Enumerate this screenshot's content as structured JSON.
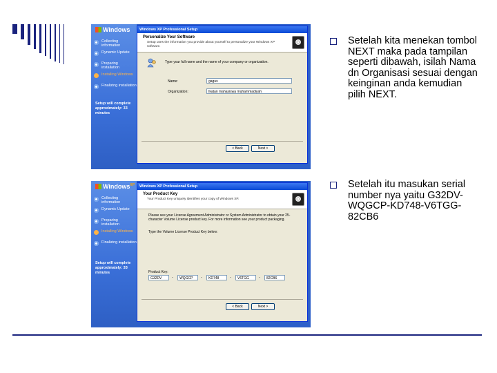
{
  "shot1": {
    "logo": "Windows",
    "steps": [
      "Collecting information",
      "Dynamic Update",
      "Preparing installation",
      "Installing Windows",
      "Finalizing installation"
    ],
    "remaining": "Setup will complete approximately: 33 minutes",
    "dialog_title": "Windows XP Professional Setup",
    "header_title": "Personalize Your Software",
    "header_sub": "Setup uses the information you provide about yourself to personalize your Windows XP software.",
    "prompt": "Type your full name and the name of your company or organization.",
    "name_label": "Name:",
    "name_value": "gagus",
    "org_label": "Organization:",
    "org_value": "Ikatan mahasiswa muhammadiyah",
    "back_label": "< Back",
    "next_label": "Next >"
  },
  "shot2": {
    "logo": "Windows",
    "logo_sup": "XP",
    "steps": [
      "Collecting information",
      "Dynamic Update",
      "Preparing installation",
      "Installing Windows",
      "Finalizing installation"
    ],
    "remaining": "Setup will complete approximately: 33 minutes",
    "dialog_title": "Windows XP Professional Setup",
    "header_title": "Your Product Key",
    "header_sub": "Your Product Key uniquely identifies your copy of Windows XP.",
    "para": "Please see your License Agreement Administrator or System Administrator to obtain your 25-character Volume License product key. For more information see your product packaging.",
    "prompt": "Type the Volume License Product Key below:",
    "key_label": "Product Key:",
    "key_parts": [
      "G32DV",
      "WQGCP",
      "KD748",
      "V6TGG",
      "82CB6"
    ],
    "back_label": "< Back",
    "next_label": "Next >"
  },
  "bullets": [
    "Setelah kita menekan tombol NEXT maka pada tampilan seperti dibawah, isilah Nama dn Organisasi sesuai dengan keinginan anda kemudian pilih NEXT.",
    "Setelah itu masukan serial number nya yaitu G32DV-WQGCP-KD748-V6TGG-82CB6"
  ]
}
